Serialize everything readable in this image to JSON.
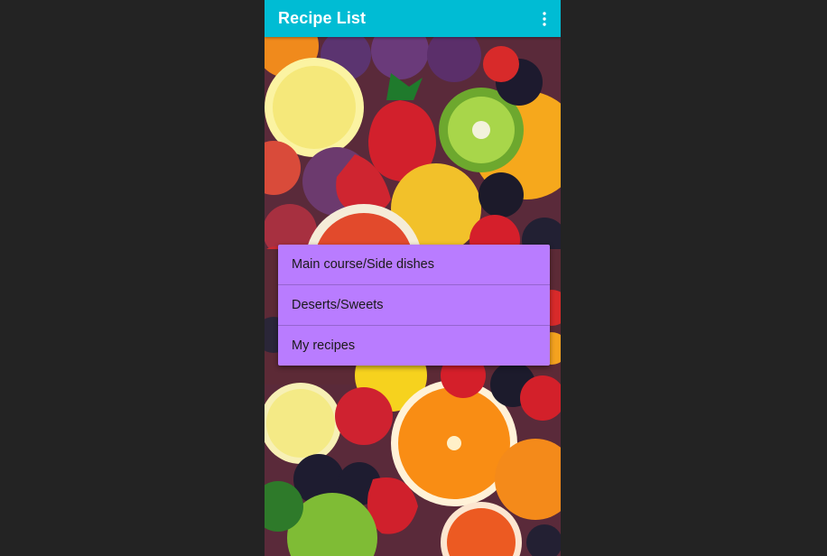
{
  "app_bar": {
    "title": "Recipe List",
    "menu_icon": "more-vert-icon",
    "color": "#00bcd4"
  },
  "background": {
    "description_icon": "fruit-background-image"
  },
  "menu": {
    "color": "#b97cff",
    "items": [
      {
        "label": "Main course/Side dishes"
      },
      {
        "label": "Deserts/Sweets"
      },
      {
        "label": "My recipes"
      }
    ]
  }
}
